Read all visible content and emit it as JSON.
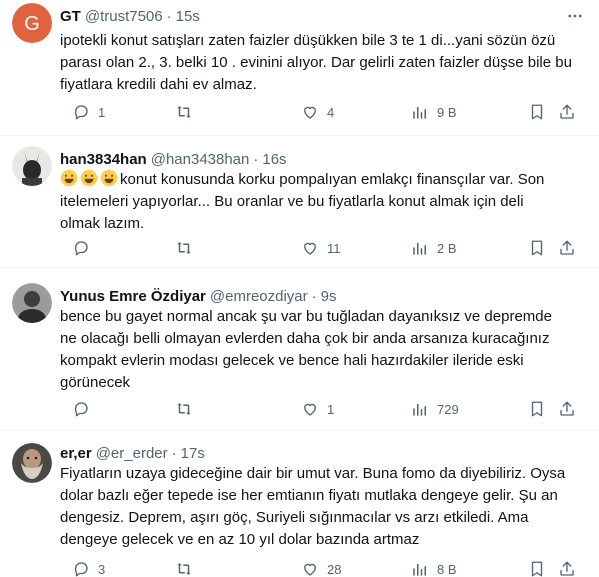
{
  "tweets": [
    {
      "name": "GT",
      "handle": "@trust7506",
      "dot": "·",
      "time": "15s",
      "avatar_letter": "G",
      "avatar_color": "#e0623f",
      "lines": [
        "ipotekli konut satışları zaten faizler düşükken bile 3 te 1 di...yani sözün özü",
        "parası olan 2., 3. belki 10 . evinini alıyor. Dar gelirli zaten faizler düşse bile bu",
        "fiyatlara kredili dahi ev almaz."
      ],
      "replies": "1",
      "retweets": "",
      "likes": "4",
      "views": "9 B"
    },
    {
      "name": "han3834han",
      "handle": "@han3438han",
      "dot": "·",
      "time": "16s",
      "lines_first_emoji_count": 3,
      "lines": [
        "konut konusunda korku pompalıyan emlakçı finansçılar var. Son",
        "itelemeleri yapıyorlar... Bu oranlar ve bu fiyatlarla konut almak için deli",
        "olmak lazım."
      ],
      "replies": "",
      "retweets": "",
      "likes": "11",
      "views": "2 B"
    },
    {
      "name": "Yunus Emre Özdiyar",
      "handle": "@emreozdiyar",
      "dot": "·",
      "time": "9s",
      "lines": [
        "bence bu gayet normal ancak şu var bu tuğladan dayanıksız ve depremde",
        "ne olacağı belli olmayan evlerden daha çok bir anda arsanıza kuracağınız",
        "kompakt evlerin modası gelecek ve bence hali hazırdakiler ileride eski",
        "görünecek"
      ],
      "replies": "",
      "retweets": "",
      "likes": "1",
      "views": "729"
    },
    {
      "name": "er,er",
      "handle": "@er_erder",
      "dot": "·",
      "time": "17s",
      "lines": [
        "Fiyatların uzaya gideceğine dair bir umut var. Buna fomo da diyebiliriz. Oysa",
        "dolar bazlı eğer tepede ise her emtianın fiyatı mutlaka dengeye gelir. Şu an",
        "dengesiz. Deprem, aşırı göç, Suriyeli sığınmacılar vs arzı etkiledi. Ama",
        "dengeye gelecek ve en az 10 yıl dolar bazında artmaz"
      ],
      "replies": "3",
      "retweets": "",
      "likes": "28",
      "views": "8 B"
    }
  ],
  "icons": {
    "reply": "reply-icon",
    "retweet": "retweet-icon",
    "like": "like-icon",
    "views": "views-icon",
    "bookmark": "bookmark-icon",
    "share": "share-icon",
    "more": "more-icon"
  },
  "colors": {
    "text": "#0f1419",
    "secondary": "#536471",
    "divider": "#eff3f4",
    "emoji": "#ffcc4d"
  }
}
